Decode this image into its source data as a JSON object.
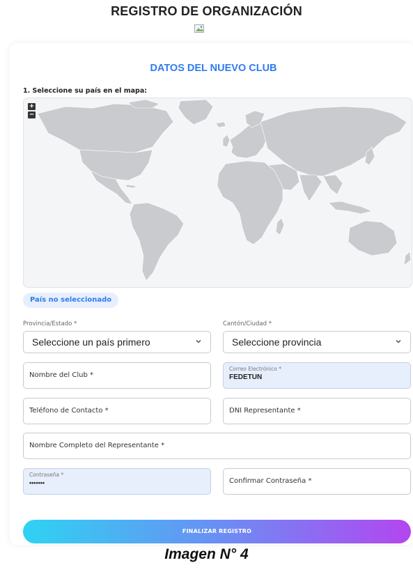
{
  "page": {
    "title": "REGISTRO DE ORGANIZACIÓN",
    "caption": "Imagen N° 4"
  },
  "form": {
    "section_title": "DATOS DEL NUEVO CLUB",
    "map_label": "1. Seleccione su país en el mapa:",
    "map_zoom_in": "+",
    "map_zoom_out": "−",
    "country_status": "País no seleccionado",
    "province": {
      "label": "Provincia/Estado *",
      "value": "Seleccione un país primero"
    },
    "city": {
      "label": "Cantón/Ciudad *",
      "value": "Seleccione provincia"
    },
    "club_name": {
      "placeholder": "Nombre del Club *"
    },
    "email": {
      "label": "Correo Electrónico *",
      "value": "FEDETUN"
    },
    "phone": {
      "placeholder": "Teléfono de Contacto *"
    },
    "dni": {
      "placeholder": "DNI Representante *"
    },
    "rep_name": {
      "placeholder": "Nombre Completo del Representante *"
    },
    "password": {
      "label": "Contraseña *",
      "value": "•••••••"
    },
    "confirm_password": {
      "placeholder": "Confirmar Contraseña *"
    },
    "submit_label": "FINALIZAR REGISTRO"
  },
  "colors": {
    "accent": "#2f7bf0",
    "map_land": "#c9cbce",
    "filled_bg": "#e7effc",
    "gradient_start": "#2ed3f2",
    "gradient_end": "#b346f0"
  },
  "icons": {
    "broken_image": "broken-image-icon",
    "dropdown": "chevron-down-icon"
  }
}
